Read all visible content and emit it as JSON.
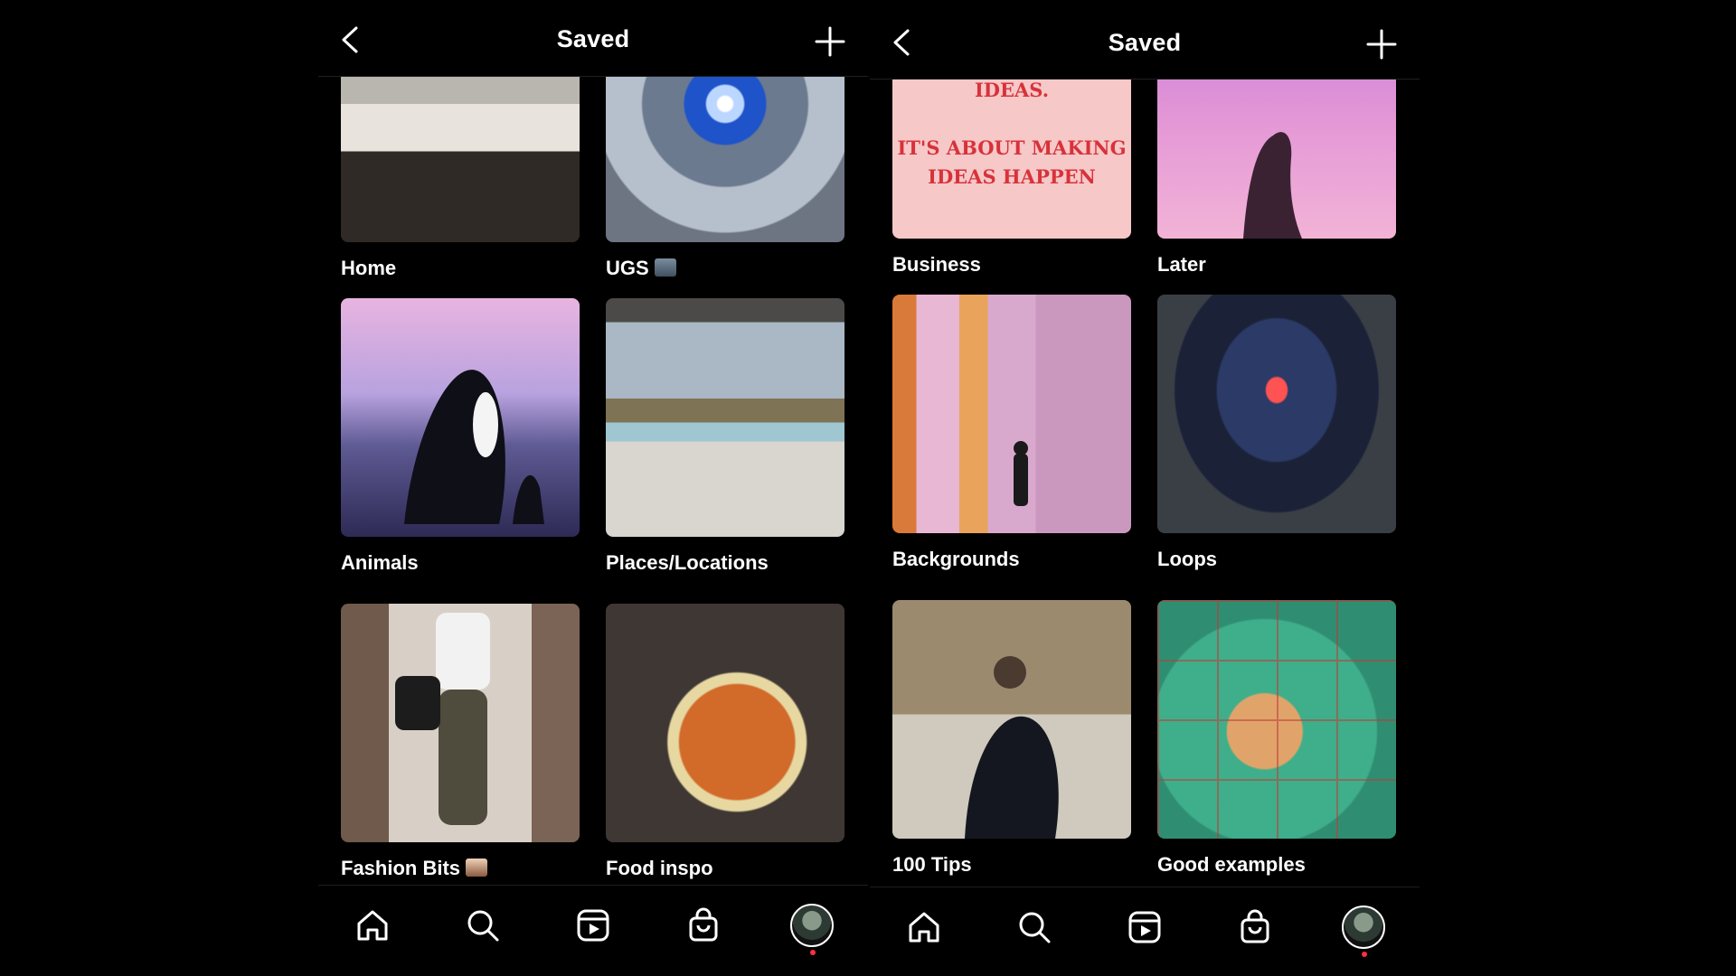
{
  "left": {
    "header": {
      "title": "Saved"
    },
    "collections": [
      {
        "label": "Home"
      },
      {
        "label": "UGS",
        "emoji": "📺"
      },
      {
        "label": "Animals"
      },
      {
        "label": "Places/Locations"
      },
      {
        "label": "Fashion Bits",
        "emoji": "💁🏻‍♂️"
      },
      {
        "label": "Food inspo"
      }
    ]
  },
  "right": {
    "header": {
      "title": "Saved"
    },
    "collections": [
      {
        "label": "Business",
        "image_text_1": "IDEAS.",
        "image_text_2": "IT'S ABOUT MAKING",
        "image_text_3": "IDEAS HAPPEN"
      },
      {
        "label": "Later"
      },
      {
        "label": "Backgrounds"
      },
      {
        "label": "Loops"
      },
      {
        "label": "100 Tips"
      },
      {
        "label": "Good examples"
      }
    ]
  },
  "nav": {
    "icons": [
      "home-icon",
      "search-icon",
      "reels-icon",
      "shop-icon",
      "profile-avatar"
    ],
    "notification_color": "#ff3040"
  }
}
